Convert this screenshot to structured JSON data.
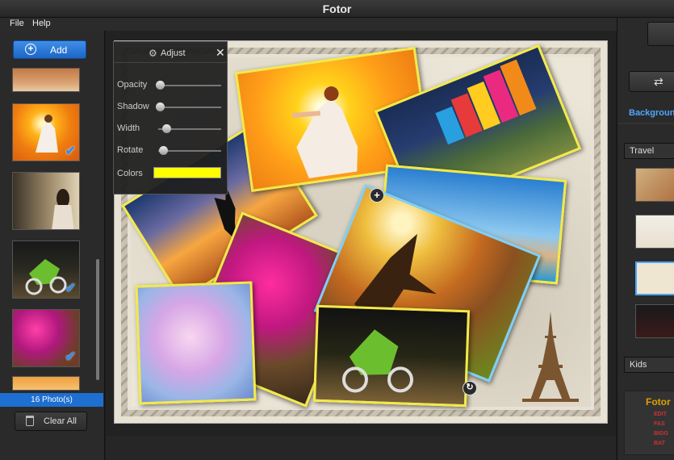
{
  "app": {
    "title": "Fotor"
  },
  "menu": {
    "file": "File",
    "help": "Help"
  },
  "left_panel": {
    "add_label": "Add",
    "photo_count": "16 Photo(s)",
    "clear_label": "Clear All"
  },
  "adjust_panel": {
    "title": "Adjust",
    "sliders": [
      {
        "label": "Opacity",
        "value": 0.0
      },
      {
        "label": "Shadow",
        "value": 0.0
      },
      {
        "label": "Width",
        "value": 0.1
      },
      {
        "label": "Rotate",
        "value": 0.05
      }
    ],
    "colors_label": "Colors",
    "color_value": "#ffff00"
  },
  "right_panel": {
    "tab_label": "Background",
    "sections": {
      "travel": "Travel",
      "kids": "Kids"
    },
    "promo_title": "Fotor",
    "promo_bullets": [
      "EDIT",
      "FAS",
      "BIGG",
      "BAT"
    ]
  },
  "colors": {
    "accent": "#1d6fd1",
    "frame_yellow": "#f2e94a",
    "selected_frame": "#7fd0f5"
  }
}
